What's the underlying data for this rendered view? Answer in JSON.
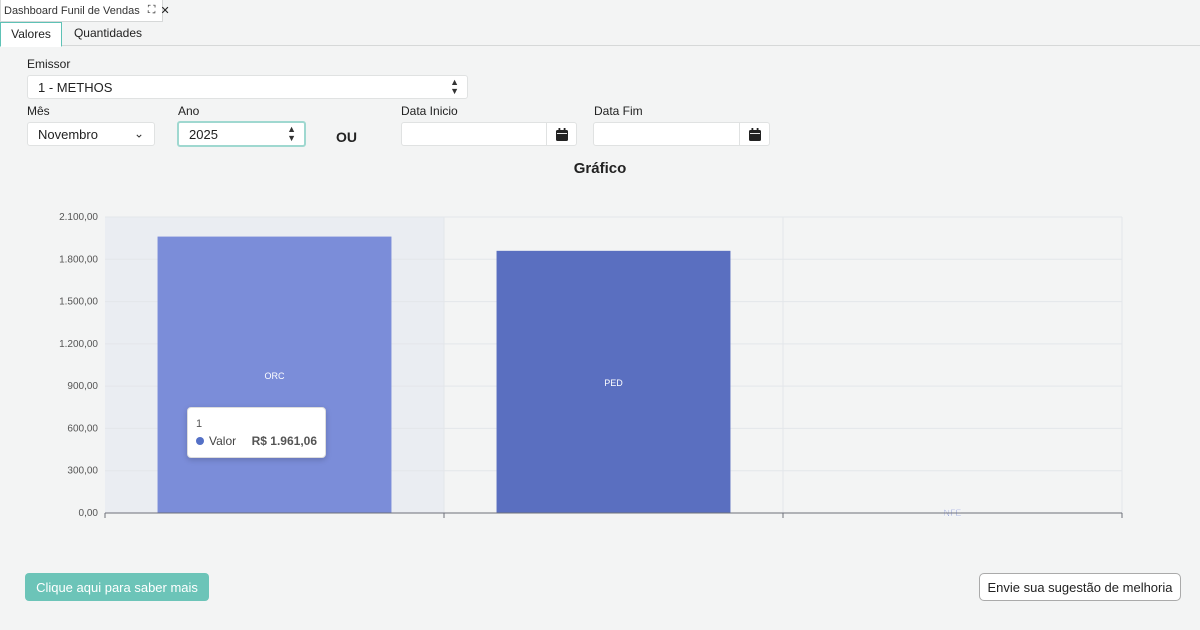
{
  "doc_tab": {
    "title": "Dashboard Funil de Vendas",
    "expand_icon": "expand-icon",
    "close_icon": "close-icon"
  },
  "tabs": [
    {
      "label": "Valores",
      "active": true
    },
    {
      "label": "Quantidades",
      "active": false
    }
  ],
  "filters": {
    "emissor_label": "Emissor",
    "emissor_value": "1 - METHOS",
    "mes_label": "Mês",
    "mes_value": "Novembro",
    "ano_label": "Ano",
    "ano_value": "2025",
    "ou_label": "OU",
    "data_inicio_label": "Data Inicio",
    "data_inicio_value": "",
    "data_fim_label": "Data Fim",
    "data_fim_value": "",
    "calendar_icon": "calendar-icon"
  },
  "chart_data": {
    "type": "bar",
    "title": "Gráfico",
    "categories": [
      "ORC",
      "PED",
      "NFE"
    ],
    "series": [
      {
        "values": [
          1961.06,
          1860,
          0
        ]
      }
    ],
    "bar_labels": [
      "ORC",
      "PED",
      "NFE"
    ],
    "ylim": [
      0,
      2100
    ],
    "yticks": [
      0,
      300,
      600,
      900,
      1200,
      1500,
      1800,
      2100
    ],
    "ytick_labels": [
      "0,00",
      "300,00",
      "600,00",
      "900,00",
      "1.200,00",
      "1.500,00",
      "1.800,00",
      "2.100,00"
    ],
    "grid": true,
    "highlighted_category": "ORC",
    "colors": [
      "#7b8dd9",
      "#5a6fc0",
      "#5a6fc0"
    ],
    "tooltip": {
      "header": "1",
      "series_name": "Valor",
      "value": "R$ 1.961,06"
    }
  },
  "buttons": {
    "saiba_mais": "Clique aqui para saber mais",
    "sugestao": "Envie sua sugestão de melhoria"
  },
  "colors": {
    "accent": "#6cc4b8",
    "focus_border": "#9fd8d0"
  }
}
